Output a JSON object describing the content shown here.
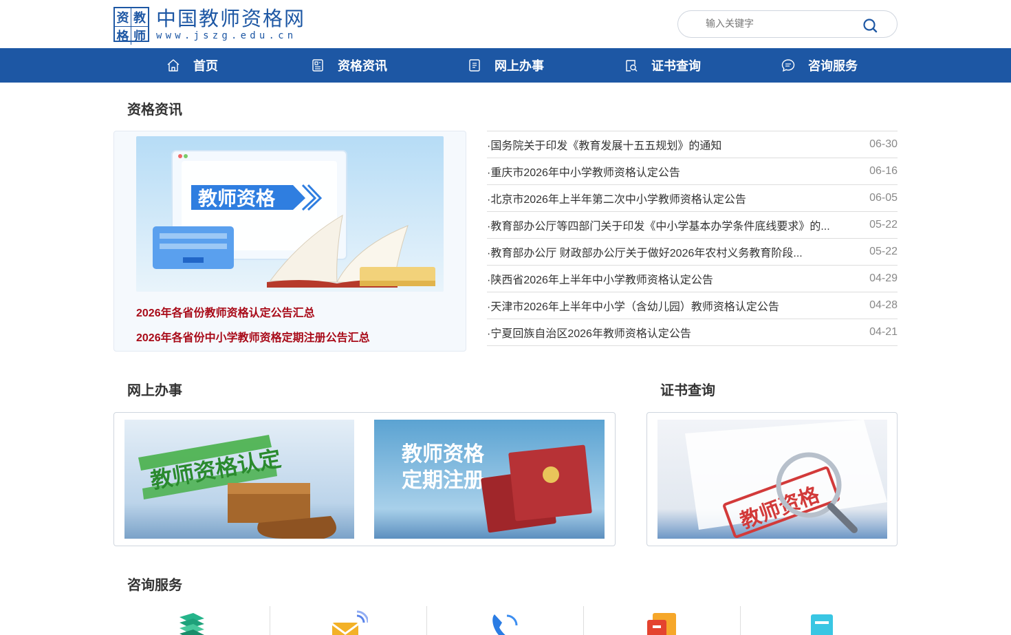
{
  "site": {
    "logo_chars": [
      "资",
      "教",
      "格",
      "师"
    ],
    "title": "中国教师资格网",
    "domain": "www.jszg.edu.cn"
  },
  "search": {
    "placeholder": "输入关键字"
  },
  "nav": [
    {
      "label": "首页",
      "icon": "home-icon"
    },
    {
      "label": "资格资讯",
      "icon": "newspaper-icon"
    },
    {
      "label": "网上办事",
      "icon": "document-icon"
    },
    {
      "label": "证书查询",
      "icon": "certificate-search-icon"
    },
    {
      "label": "咨询服务",
      "icon": "chat-bubble-icon"
    }
  ],
  "news": {
    "title": "资格资讯",
    "banner_text": "教师资格",
    "feature_links": [
      "2026年各省份教师资格认定公告汇总",
      "2026年各省份中小学教师资格定期注册公告汇总"
    ],
    "items": [
      {
        "title": "·国务院关于印发《教育发展十五五规划》的通知",
        "date": "06-30"
      },
      {
        "title": "·重庆市2026年中小学教师资格认定公告",
        "date": "06-16"
      },
      {
        "title": "·北京市2026年上半年第二次中小学教师资格认定公告",
        "date": "06-05"
      },
      {
        "title": "·教育部办公厅等四部门关于印发《中小学基本办学条件底线要求》的...",
        "date": "05-22"
      },
      {
        "title": "·教育部办公厅 财政部办公厅关于做好2026年农村义务教育阶段...",
        "date": "05-22"
      },
      {
        "title": "·陕西省2026年上半年中小学教师资格认定公告",
        "date": "04-29"
      },
      {
        "title": "·天津市2026年上半年中小学（含幼儿园）教师资格认定公告",
        "date": "04-28"
      },
      {
        "title": "·宁夏回族自治区2026年教师资格认定公告",
        "date": "04-21"
      }
    ]
  },
  "online": {
    "title": "网上办事",
    "cards": [
      {
        "text": "教师资格认定"
      },
      {
        "text_line1": "教师资格",
        "text_line2": "定期注册"
      }
    ]
  },
  "cert": {
    "title": "证书查询",
    "stamp_text": "教师资格"
  },
  "consult": {
    "title": "咨询服务",
    "items": [
      {
        "icon": "stack-icon"
      },
      {
        "icon": "mail-icon"
      },
      {
        "icon": "phone-icon"
      },
      {
        "icon": "folder-icon"
      },
      {
        "icon": "clipboard-icon"
      }
    ]
  },
  "colors": {
    "brand": "#1d57a4",
    "link_red": "#a80a18"
  }
}
